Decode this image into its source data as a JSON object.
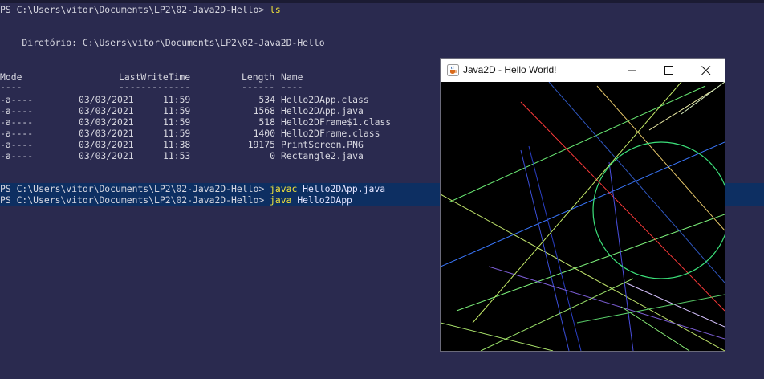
{
  "terminal": {
    "prompt1": "PS C:\\Users\\vitor\\Documents\\LP2\\02-Java2D-Hello> ",
    "cmd1": "ls",
    "dir_line": "    Diretório: C:\\Users\\vitor\\Documents\\LP2\\02-Java2D-Hello",
    "headers": {
      "mode": "Mode",
      "lastwrite": "LastWriteTime",
      "length": "Length",
      "name": "Name"
    },
    "underlines": {
      "mode": "----",
      "lastwrite": "-------------",
      "length": "------",
      "name": "----"
    },
    "rows": [
      {
        "mode": "-a----",
        "date": "03/03/2021",
        "time": "11:59",
        "length": "534",
        "name": "Hello2DApp.class"
      },
      {
        "mode": "-a----",
        "date": "03/03/2021",
        "time": "11:59",
        "length": "1568",
        "name": "Hello2DApp.java"
      },
      {
        "mode": "-a----",
        "date": "03/03/2021",
        "time": "11:59",
        "length": "518",
        "name": "Hello2DFrame$1.class"
      },
      {
        "mode": "-a----",
        "date": "03/03/2021",
        "time": "11:59",
        "length": "1400",
        "name": "Hello2DFrame.class"
      },
      {
        "mode": "-a----",
        "date": "03/03/2021",
        "time": "11:38",
        "length": "19175",
        "name": "PrintScreen.PNG"
      },
      {
        "mode": "-a----",
        "date": "03/03/2021",
        "time": "11:53",
        "length": "0",
        "name": "Rectangle2.java"
      }
    ],
    "prompt2": "PS C:\\Users\\vitor\\Documents\\LP2\\02-Java2D-Hello> ",
    "cmd2": "javac",
    "arg2": " Hello2DApp.java",
    "prompt3": "PS C:\\Users\\vitor\\Documents\\LP2\\02-Java2D-Hello> ",
    "cmd3": "java",
    "arg3": " Hello2DApp"
  },
  "window": {
    "title": "Java2D - Hello World!",
    "icon": "java-cup-icon",
    "buttons": [
      "minimize-icon",
      "maximize-icon",
      "close-icon"
    ]
  },
  "colors": {
    "terminal_bg": "#2a2a4f",
    "command_highlight": "#0d2f62",
    "command_yellow": "#f0e23a",
    "canvas_bg": "#000000"
  }
}
